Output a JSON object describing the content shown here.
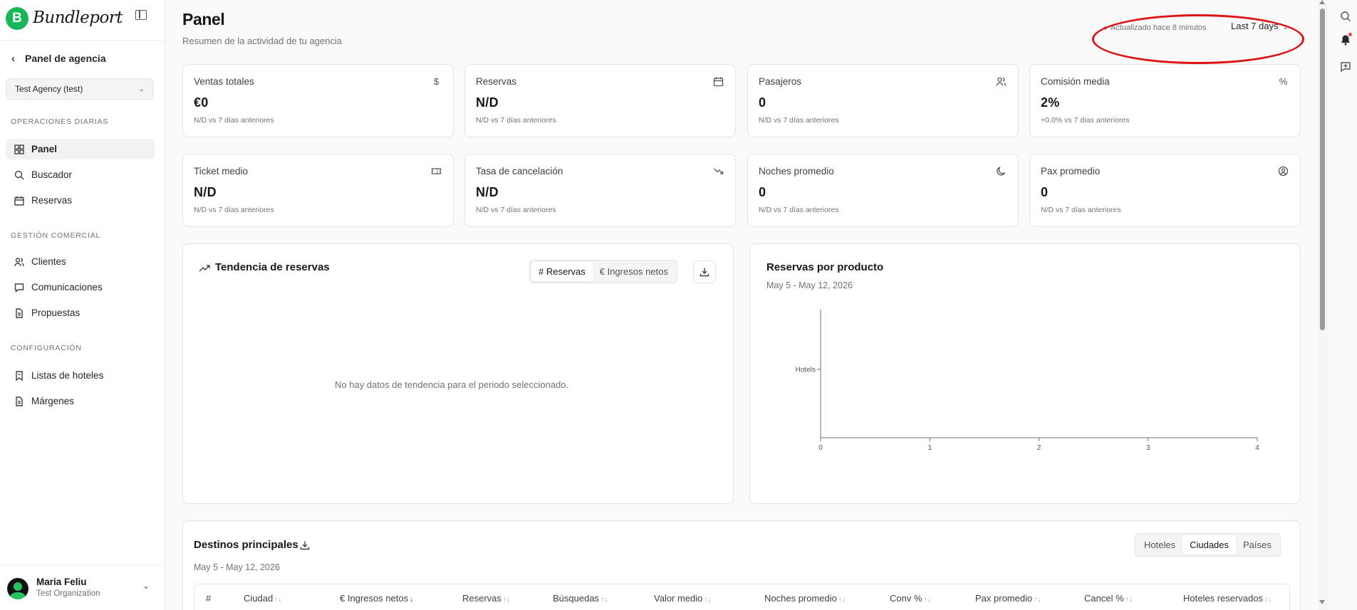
{
  "brand": {
    "logo_letter": "B",
    "name": "Bundleport"
  },
  "sidebar": {
    "back_label": "Panel de agencia",
    "agency_select": "Test Agency (test)",
    "sections": [
      {
        "title": "Operaciones diarias",
        "items": [
          {
            "label": "Panel",
            "icon": "layout-grid-icon",
            "active": true
          },
          {
            "label": "Buscador",
            "icon": "search-icon"
          },
          {
            "label": "Reservas",
            "icon": "calendar-icon"
          }
        ]
      },
      {
        "title": "Gestión comercial",
        "items": [
          {
            "label": "Clientes",
            "icon": "users-icon"
          },
          {
            "label": "Comunicaciones",
            "icon": "message-icon"
          },
          {
            "label": "Propuestas",
            "icon": "document-icon"
          }
        ]
      },
      {
        "title": "Configuración",
        "items": [
          {
            "label": "Listas de hoteles",
            "icon": "bookmark-list-icon"
          },
          {
            "label": "Márgenes",
            "icon": "document-icon"
          }
        ]
      }
    ],
    "user": {
      "name": "Maria Feliu",
      "organization": "Test Organization"
    }
  },
  "header": {
    "title": "Panel",
    "subtitle": "Resumen de la actividad de tu agencia",
    "updated": "Actualizado hace 8 minutos",
    "range": "Last 7 days"
  },
  "kpis": [
    {
      "label": "Ventas totales",
      "value": "€0",
      "delta": "N/D vs 7 días anteriores",
      "icon": "dollar-icon"
    },
    {
      "label": "Reservas",
      "value": "N/D",
      "delta": "N/D vs 7 días anteriores",
      "icon": "calendar-icon"
    },
    {
      "label": "Pasajeros",
      "value": "0",
      "delta": "N/D vs 7 días anteriores",
      "icon": "users-icon"
    },
    {
      "label": "Comisión media",
      "value": "2%",
      "delta": "+0.0% vs 7 días anteriores",
      "icon": "percent-icon"
    },
    {
      "label": "Ticket medio",
      "value": "N/D",
      "delta": "N/D vs 7 días anteriores",
      "icon": "ticket-icon"
    },
    {
      "label": "Tasa de cancelación",
      "value": "N/D",
      "delta": "N/D vs 7 días anteriores",
      "icon": "trending-down-icon"
    },
    {
      "label": "Noches promedio",
      "value": "0",
      "delta": "N/D vs 7 días anteriores",
      "icon": "moon-icon"
    },
    {
      "label": "Pax promedio",
      "value": "0",
      "delta": "N/D vs 7 días anteriores",
      "icon": "user-circle-icon"
    }
  ],
  "trend": {
    "title": "Tendencia de reservas",
    "toggle": [
      "# Reservas",
      "€ Ingresos netos"
    ],
    "empty": "No hay datos de tendencia para el periodo seleccionado."
  },
  "by_product": {
    "title": "Reservas por producto",
    "range": "May 5 - May 12, 2026"
  },
  "chart_data": {
    "type": "bar",
    "orientation": "horizontal",
    "title": "Reservas por producto",
    "categories": [
      "Hotels"
    ],
    "values": [
      0
    ],
    "xlim": [
      0,
      4
    ],
    "xticks": [
      "0",
      "1",
      "2",
      "3",
      "4"
    ]
  },
  "destinations": {
    "title": "Destinos principales",
    "range": "May 5 - May 12, 2026",
    "toggle": [
      "Hoteles",
      "Ciudades",
      "Países"
    ],
    "columns": [
      "#",
      "Ciudad",
      "€ Ingresos netos",
      "Reservas",
      "Búsquedas",
      "Valor medio",
      "Noches promedio",
      "Conv %",
      "Pax promedio",
      "Cancel %",
      "Hoteles reservados"
    ]
  },
  "colors": {
    "brand": "#18b85a",
    "annotation": "#dc1414",
    "notification": "#ef4444"
  }
}
